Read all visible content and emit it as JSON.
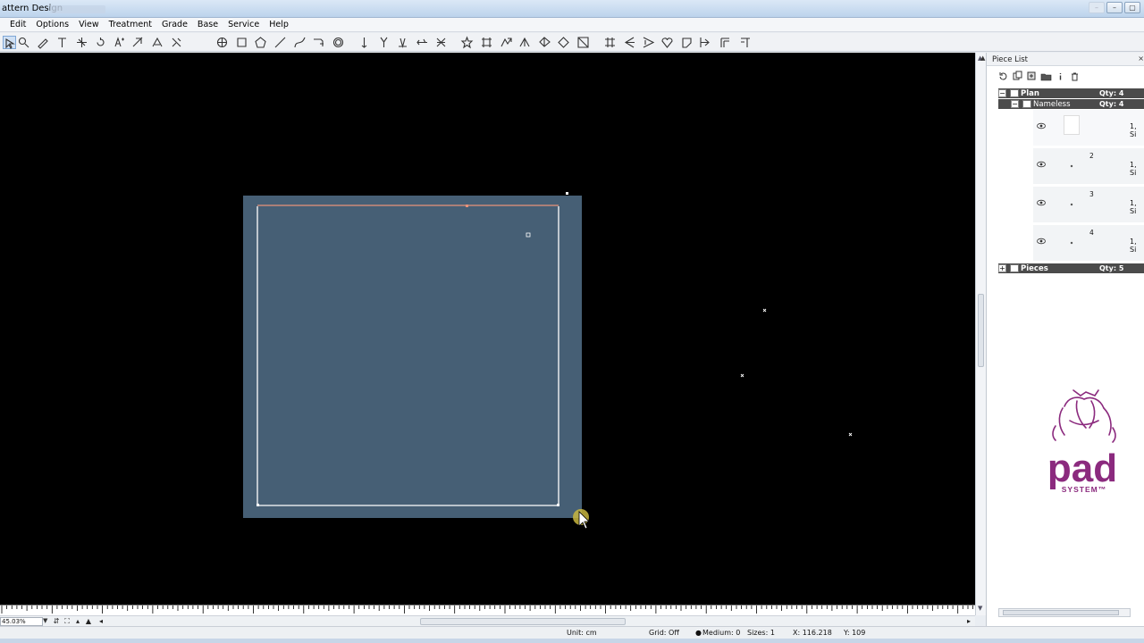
{
  "app": {
    "title": "attern Design"
  },
  "menu": [
    "Edit",
    "Options",
    "View",
    "Treatment",
    "Grade",
    "Base",
    "Service",
    "Help"
  ],
  "toolbar": {
    "tools": [
      "select-tool",
      "zoom-tool",
      "pencil-tool",
      "text-tool",
      "snap-tool",
      "rotate-tool",
      "grade-tool",
      "split-tool",
      "measure-tool",
      "cut-tool",
      "circle-tool",
      "rectangle-tool",
      "polygon-tool",
      "line-tool",
      "curve-tool",
      "fold-tool",
      "spiral-tool",
      "pin-tool",
      "notch-tool",
      "dart-tool",
      "offset-tool",
      "mirror-tool",
      "star-tool",
      "column-tool",
      "transform-tool",
      "fold-line-tool",
      "seam-tool",
      "pleat-tool",
      "gather-tool",
      "shrink-tool",
      "align-tool",
      "angle-tool",
      "heart-tool",
      "marker-tool",
      "arrow-tool",
      "corner-tool",
      "corner-alt-tool"
    ]
  },
  "bottom_bar": {
    "zoom": "45.03%"
  },
  "status": {
    "unit": "Unit: cm",
    "grid": "Grid: Off",
    "medium": "Medium: 0",
    "sizes": "Sizes: 1",
    "x": "X: 116.218",
    "y": "Y: 109"
  },
  "panel": {
    "title": "Piece List",
    "tree": {
      "plan": {
        "label": "Plan",
        "qty": "Qty: 4"
      },
      "nameless": {
        "label": "Nameless",
        "qty": "Qty: 4"
      },
      "pieces": [
        {
          "number": "",
          "label": "1, Si"
        },
        {
          "number": "2",
          "label": "1, Si"
        },
        {
          "number": "3",
          "label": "1, Si"
        },
        {
          "number": "4",
          "label": "1, Si"
        }
      ],
      "pieces_group": {
        "label": "Pieces",
        "qty": "Qty: 5"
      }
    }
  },
  "logo": {
    "text": "pad",
    "subtext": "SYSTEM™",
    "color": "#8b2a7e"
  },
  "colors": {
    "canvas_bg": "#000000",
    "piece_fill": "#465f75",
    "panel_header_bg": "#4b4b4b",
    "accent": "#7fa7d6"
  }
}
